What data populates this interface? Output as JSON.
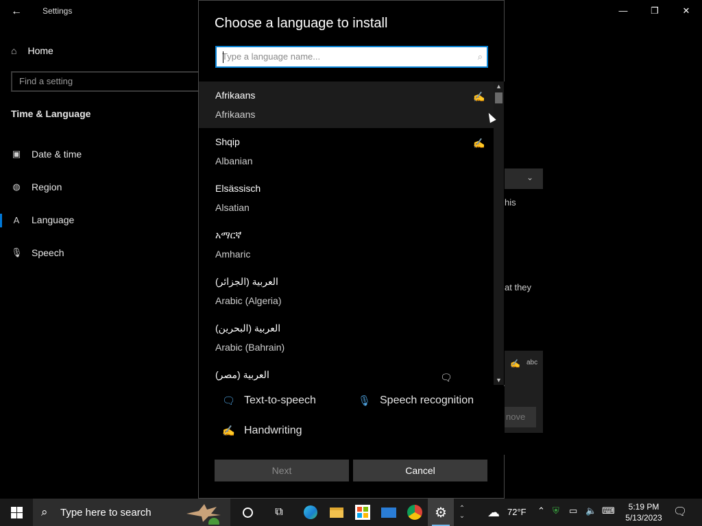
{
  "window": {
    "title": "Settings",
    "back": "←",
    "minimize": "—",
    "restore": "❐",
    "close": "✕"
  },
  "nav": {
    "home": "Home",
    "search_placeholder": "Find a setting",
    "section": "Time & Language",
    "items": [
      {
        "label": "Date & time",
        "icon": "calendar-clock-icon"
      },
      {
        "label": "Region",
        "icon": "globe-icon"
      },
      {
        "label": "Language",
        "icon": "language-icon"
      },
      {
        "label": "Speech",
        "icon": "microphone-icon"
      }
    ]
  },
  "background_fragments": {
    "text1": "his",
    "text2": "at they",
    "button": "nove"
  },
  "dialog": {
    "title": "Choose a language to install",
    "search_placeholder": "Type a language name...",
    "languages": [
      {
        "native": "Afrikaans",
        "english": "Afrikaans",
        "features": [
          "handwriting-icon"
        ],
        "hover": true
      },
      {
        "native": "Shqip",
        "english": "Albanian",
        "features": [
          "handwriting-icon"
        ],
        "hover": false
      },
      {
        "native": "Elsässisch",
        "english": "Alsatian",
        "features": [],
        "hover": false
      },
      {
        "native": "አማርኛ",
        "english": "Amharic",
        "features": [],
        "hover": false
      },
      {
        "native": "العربية (الجزائر)",
        "english": "Arabic (Algeria)",
        "features": [],
        "hover": false
      },
      {
        "native": "العربية (البحرين)",
        "english": "Arabic (Bahrain)",
        "features": [],
        "hover": false
      },
      {
        "native": "العربية (مصر)",
        "english": "",
        "features": [
          "text-to-speech-icon"
        ],
        "hover": false
      }
    ],
    "legend": {
      "tts": "Text-to-speech",
      "speech": "Speech recognition",
      "handwriting": "Handwriting"
    },
    "next": "Next",
    "cancel": "Cancel"
  },
  "taskbar": {
    "search_text": "Type here to search",
    "weather": "72°F",
    "time": "5:19 PM",
    "date": "5/13/2023"
  },
  "colors": {
    "accent": "#0078d7",
    "icon_blue": "#4fa3e0"
  }
}
